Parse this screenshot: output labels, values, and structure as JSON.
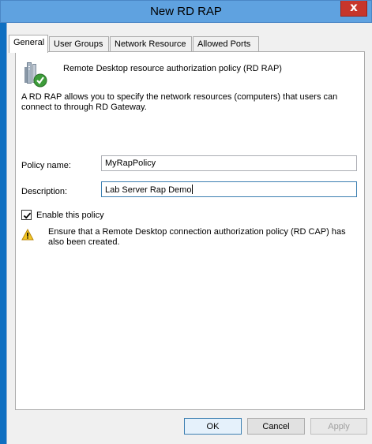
{
  "window": {
    "title": "New RD RAP",
    "close_glyph": "x"
  },
  "tabs": [
    {
      "label": "General",
      "active": true
    },
    {
      "label": "User Groups",
      "active": false
    },
    {
      "label": "Network Resource",
      "active": false
    },
    {
      "label": "Allowed Ports",
      "active": false
    }
  ],
  "general": {
    "heading": "Remote Desktop resource authorization policy (RD RAP)",
    "heading_icon": "policy-document-check-icon",
    "description": "A RD RAP allows you to specify the network resources (computers) that users can connect to through RD Gateway.",
    "policy_name_label": "Policy name:",
    "policy_name_value": "MyRapPolicy",
    "description_label": "Description:",
    "description_value": "Lab Server Rap Demo",
    "enable_label": "Enable this policy",
    "enable_checked": true,
    "warning_icon": "warning-icon",
    "warning_text": "Ensure that a Remote Desktop connection authorization policy (RD CAP) has also been created."
  },
  "buttons": {
    "ok": "OK",
    "cancel": "Cancel",
    "apply": "Apply"
  },
  "colors": {
    "titlebar": "#5fa2e0",
    "close_button": "#c7362b",
    "frame": "#0f6fc1"
  }
}
